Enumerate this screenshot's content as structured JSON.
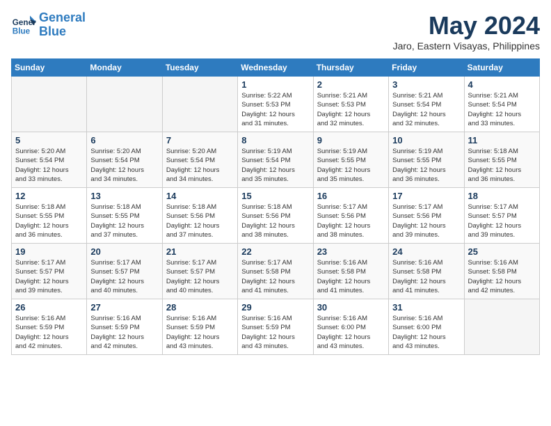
{
  "header": {
    "logo_line1": "General",
    "logo_line2": "Blue",
    "month_title": "May 2024",
    "location": "Jaro, Eastern Visayas, Philippines"
  },
  "weekdays": [
    "Sunday",
    "Monday",
    "Tuesday",
    "Wednesday",
    "Thursday",
    "Friday",
    "Saturday"
  ],
  "weeks": [
    {
      "days": [
        {
          "num": "",
          "info": ""
        },
        {
          "num": "",
          "info": ""
        },
        {
          "num": "",
          "info": ""
        },
        {
          "num": "1",
          "info": "Sunrise: 5:22 AM\nSunset: 5:53 PM\nDaylight: 12 hours\nand 31 minutes."
        },
        {
          "num": "2",
          "info": "Sunrise: 5:21 AM\nSunset: 5:53 PM\nDaylight: 12 hours\nand 32 minutes."
        },
        {
          "num": "3",
          "info": "Sunrise: 5:21 AM\nSunset: 5:54 PM\nDaylight: 12 hours\nand 32 minutes."
        },
        {
          "num": "4",
          "info": "Sunrise: 5:21 AM\nSunset: 5:54 PM\nDaylight: 12 hours\nand 33 minutes."
        }
      ]
    },
    {
      "days": [
        {
          "num": "5",
          "info": "Sunrise: 5:20 AM\nSunset: 5:54 PM\nDaylight: 12 hours\nand 33 minutes."
        },
        {
          "num": "6",
          "info": "Sunrise: 5:20 AM\nSunset: 5:54 PM\nDaylight: 12 hours\nand 34 minutes."
        },
        {
          "num": "7",
          "info": "Sunrise: 5:20 AM\nSunset: 5:54 PM\nDaylight: 12 hours\nand 34 minutes."
        },
        {
          "num": "8",
          "info": "Sunrise: 5:19 AM\nSunset: 5:54 PM\nDaylight: 12 hours\nand 35 minutes."
        },
        {
          "num": "9",
          "info": "Sunrise: 5:19 AM\nSunset: 5:55 PM\nDaylight: 12 hours\nand 35 minutes."
        },
        {
          "num": "10",
          "info": "Sunrise: 5:19 AM\nSunset: 5:55 PM\nDaylight: 12 hours\nand 36 minutes."
        },
        {
          "num": "11",
          "info": "Sunrise: 5:18 AM\nSunset: 5:55 PM\nDaylight: 12 hours\nand 36 minutes."
        }
      ]
    },
    {
      "days": [
        {
          "num": "12",
          "info": "Sunrise: 5:18 AM\nSunset: 5:55 PM\nDaylight: 12 hours\nand 36 minutes."
        },
        {
          "num": "13",
          "info": "Sunrise: 5:18 AM\nSunset: 5:55 PM\nDaylight: 12 hours\nand 37 minutes."
        },
        {
          "num": "14",
          "info": "Sunrise: 5:18 AM\nSunset: 5:56 PM\nDaylight: 12 hours\nand 37 minutes."
        },
        {
          "num": "15",
          "info": "Sunrise: 5:18 AM\nSunset: 5:56 PM\nDaylight: 12 hours\nand 38 minutes."
        },
        {
          "num": "16",
          "info": "Sunrise: 5:17 AM\nSunset: 5:56 PM\nDaylight: 12 hours\nand 38 minutes."
        },
        {
          "num": "17",
          "info": "Sunrise: 5:17 AM\nSunset: 5:56 PM\nDaylight: 12 hours\nand 39 minutes."
        },
        {
          "num": "18",
          "info": "Sunrise: 5:17 AM\nSunset: 5:57 PM\nDaylight: 12 hours\nand 39 minutes."
        }
      ]
    },
    {
      "days": [
        {
          "num": "19",
          "info": "Sunrise: 5:17 AM\nSunset: 5:57 PM\nDaylight: 12 hours\nand 39 minutes."
        },
        {
          "num": "20",
          "info": "Sunrise: 5:17 AM\nSunset: 5:57 PM\nDaylight: 12 hours\nand 40 minutes."
        },
        {
          "num": "21",
          "info": "Sunrise: 5:17 AM\nSunset: 5:57 PM\nDaylight: 12 hours\nand 40 minutes."
        },
        {
          "num": "22",
          "info": "Sunrise: 5:17 AM\nSunset: 5:58 PM\nDaylight: 12 hours\nand 41 minutes."
        },
        {
          "num": "23",
          "info": "Sunrise: 5:16 AM\nSunset: 5:58 PM\nDaylight: 12 hours\nand 41 minutes."
        },
        {
          "num": "24",
          "info": "Sunrise: 5:16 AM\nSunset: 5:58 PM\nDaylight: 12 hours\nand 41 minutes."
        },
        {
          "num": "25",
          "info": "Sunrise: 5:16 AM\nSunset: 5:58 PM\nDaylight: 12 hours\nand 42 minutes."
        }
      ]
    },
    {
      "days": [
        {
          "num": "26",
          "info": "Sunrise: 5:16 AM\nSunset: 5:59 PM\nDaylight: 12 hours\nand 42 minutes."
        },
        {
          "num": "27",
          "info": "Sunrise: 5:16 AM\nSunset: 5:59 PM\nDaylight: 12 hours\nand 42 minutes."
        },
        {
          "num": "28",
          "info": "Sunrise: 5:16 AM\nSunset: 5:59 PM\nDaylight: 12 hours\nand 43 minutes."
        },
        {
          "num": "29",
          "info": "Sunrise: 5:16 AM\nSunset: 5:59 PM\nDaylight: 12 hours\nand 43 minutes."
        },
        {
          "num": "30",
          "info": "Sunrise: 5:16 AM\nSunset: 6:00 PM\nDaylight: 12 hours\nand 43 minutes."
        },
        {
          "num": "31",
          "info": "Sunrise: 5:16 AM\nSunset: 6:00 PM\nDaylight: 12 hours\nand 43 minutes."
        },
        {
          "num": "",
          "info": ""
        }
      ]
    }
  ]
}
